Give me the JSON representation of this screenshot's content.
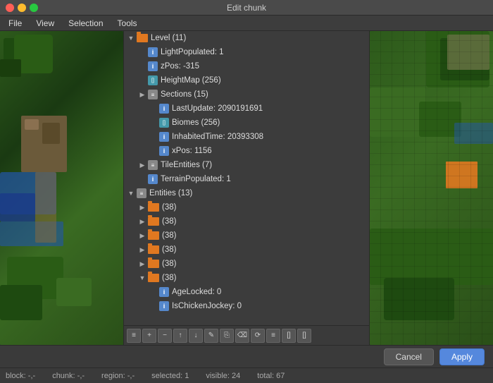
{
  "titleBar": {
    "title": "Edit chunk"
  },
  "menuBar": {
    "items": [
      "File",
      "View",
      "Selection",
      "Tools"
    ]
  },
  "tree": {
    "items": [
      {
        "id": "level",
        "indent": 0,
        "arrow": "down",
        "icon": "folder",
        "label": "Level (11)"
      },
      {
        "id": "lightpopulated",
        "indent": 1,
        "arrow": "none",
        "icon": "int",
        "label": "LightPopulated: 1"
      },
      {
        "id": "zpos",
        "indent": 1,
        "arrow": "none",
        "icon": "int",
        "label": "zPos: -315"
      },
      {
        "id": "heightmap",
        "indent": 1,
        "arrow": "none",
        "icon": "byte-arr",
        "label": "HeightMap (256)"
      },
      {
        "id": "sections",
        "indent": 1,
        "arrow": "right",
        "icon": "list",
        "label": "Sections (15)"
      },
      {
        "id": "lastupdate",
        "indent": 2,
        "arrow": "none",
        "icon": "int",
        "label": "LastUpdate: 2090191691"
      },
      {
        "id": "biomes",
        "indent": 2,
        "arrow": "none",
        "icon": "byte-arr",
        "label": "Biomes (256)"
      },
      {
        "id": "inhabitedtime",
        "indent": 2,
        "arrow": "none",
        "icon": "int",
        "label": "InhabitedTime: 20393308"
      },
      {
        "id": "xpos",
        "indent": 2,
        "arrow": "none",
        "icon": "int",
        "label": "xPos: 1156"
      },
      {
        "id": "tileentities",
        "indent": 1,
        "arrow": "right",
        "icon": "list",
        "label": "TileEntities (7)"
      },
      {
        "id": "terrainpopulated",
        "indent": 1,
        "arrow": "none",
        "icon": "int",
        "label": "TerrainPopulated: 1"
      },
      {
        "id": "entities",
        "indent": 0,
        "arrow": "down",
        "icon": "list",
        "label": "Entities (13)"
      },
      {
        "id": "entities-1",
        "indent": 1,
        "arrow": "right",
        "icon": "folder",
        "label": "(38)"
      },
      {
        "id": "entities-2",
        "indent": 1,
        "arrow": "right",
        "icon": "folder",
        "label": "(38)"
      },
      {
        "id": "entities-3",
        "indent": 1,
        "arrow": "right",
        "icon": "folder",
        "label": "(38)"
      },
      {
        "id": "entities-4",
        "indent": 1,
        "arrow": "right",
        "icon": "folder",
        "label": "(38)"
      },
      {
        "id": "entities-5",
        "indent": 1,
        "arrow": "right",
        "icon": "folder",
        "label": "(38)"
      },
      {
        "id": "entities-6",
        "indent": 1,
        "arrow": "down",
        "icon": "folder",
        "label": "(38)"
      },
      {
        "id": "agelocked",
        "indent": 2,
        "arrow": "none",
        "icon": "int",
        "label": "AgeLocked: 0"
      },
      {
        "id": "ischickenjockey",
        "indent": 2,
        "arrow": "none",
        "icon": "int",
        "label": "IsChickenJockey: 0"
      }
    ]
  },
  "toolbar": {
    "buttons": [
      "≡",
      "+",
      "−",
      "↑",
      "↓",
      "✎",
      "⎘",
      "⌫",
      "⟳",
      "≡",
      "[]",
      "[]"
    ]
  },
  "buttons": {
    "cancel": "Cancel",
    "apply": "Apply"
  },
  "statusBar": {
    "block": "block: -,-",
    "chunk": "chunk: -,-",
    "region": "region: -,-",
    "selected": "selected: 1",
    "visible": "visible: 24",
    "total": "total: 67"
  }
}
